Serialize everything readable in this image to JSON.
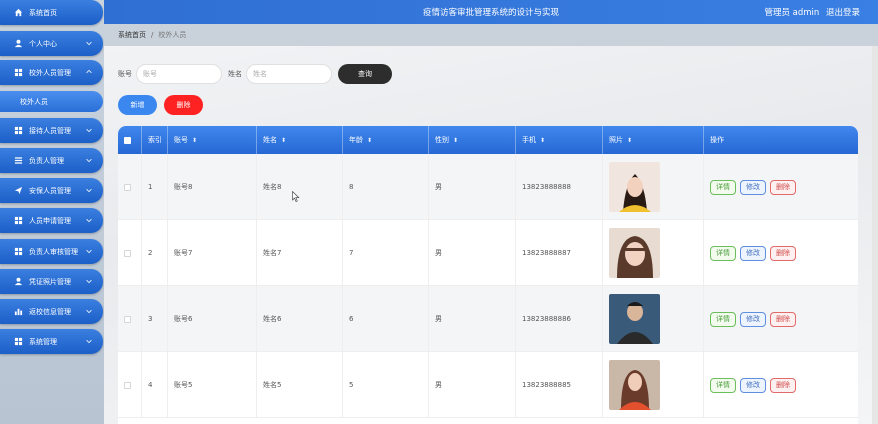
{
  "app": {
    "title": "疫情访客审批管理系统的设计与实现",
    "user_label": "管理员 admin",
    "logout": "退出登录"
  },
  "sidebar": {
    "items": [
      {
        "label": "系统首页",
        "icon": "home-icon"
      },
      {
        "label": "个人中心",
        "icon": "person-icon"
      },
      {
        "label": "校外人员管理",
        "icon": "grid-icon",
        "expanded": true
      },
      {
        "label": "接待人员管理",
        "icon": "grid-icon"
      },
      {
        "label": "负责人管理",
        "icon": "list-icon"
      },
      {
        "label": "安保人员管理",
        "icon": "send-icon"
      },
      {
        "label": "人员申请管理",
        "icon": "grid-icon"
      },
      {
        "label": "负责人审核管理",
        "icon": "grid-icon"
      },
      {
        "label": "凭证照片管理",
        "icon": "person-icon"
      },
      {
        "label": "返校信息管理",
        "icon": "chart-icon"
      },
      {
        "label": "系统管理",
        "icon": "grid-icon"
      }
    ],
    "sub_active": "校外人员"
  },
  "breadcrumb": {
    "home": "系统首页",
    "sep": "/",
    "current": "校外人员"
  },
  "search": {
    "account_label": "账号",
    "account_placeholder": "账号",
    "name_label": "姓名",
    "name_placeholder": "姓名",
    "query_button": "查询"
  },
  "actions": {
    "add": "新增",
    "delete": "删除"
  },
  "table": {
    "headers": {
      "index": "索引",
      "account": "账号",
      "name": "姓名",
      "age": "年龄",
      "gender": "性别",
      "phone": "手机",
      "photo": "照片",
      "ops": "操作"
    },
    "ops": {
      "detail": "详情",
      "edit": "修改",
      "remove": "删除"
    },
    "rows": [
      {
        "index": "1",
        "account": "账号8",
        "name": "姓名8",
        "age": "8",
        "gender": "男",
        "phone": "13823888888"
      },
      {
        "index": "2",
        "account": "账号7",
        "name": "姓名7",
        "age": "7",
        "gender": "男",
        "phone": "13823888887"
      },
      {
        "index": "3",
        "account": "账号6",
        "name": "姓名6",
        "age": "6",
        "gender": "男",
        "phone": "13823888886"
      },
      {
        "index": "4",
        "account": "账号5",
        "name": "姓名5",
        "age": "5",
        "gender": "男",
        "phone": "13823888885"
      }
    ]
  },
  "colors": {
    "primary": "#2f6fd3",
    "danger": "#ff2222",
    "dark": "#2d2d2d"
  }
}
